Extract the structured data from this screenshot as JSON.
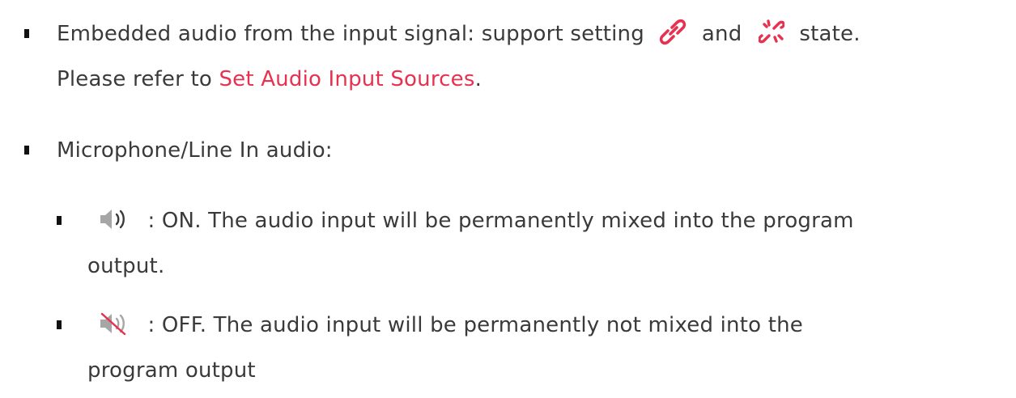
{
  "items": [
    {
      "line1_prefix": "Embedded audio from the input signal: support setting",
      "line1_and": "and",
      "line1_suffix": "state.",
      "line2_prefix": "Please refer to",
      "link_text": "Set Audio Input Sources",
      "line2_suffix": ".",
      "icons": [
        "link-icon",
        "unlink-icon"
      ],
      "icon_color": "#e8314f"
    },
    {
      "text": "Microphone/Line In audio:"
    }
  ],
  "sub_items": [
    {
      "icon": "speaker-on-icon",
      "line1": ": ON. The audio input will be permanently mixed into the program",
      "line2": "output."
    },
    {
      "icon": "speaker-muted-icon",
      "line1": ": OFF. The audio input will be permanently not mixed into the",
      "line2": "program output"
    }
  ],
  "colors": {
    "text": "#3a3a3a",
    "link": "#e8314f",
    "icon_gray": "#a6a6a6",
    "bullet": "#111111"
  }
}
